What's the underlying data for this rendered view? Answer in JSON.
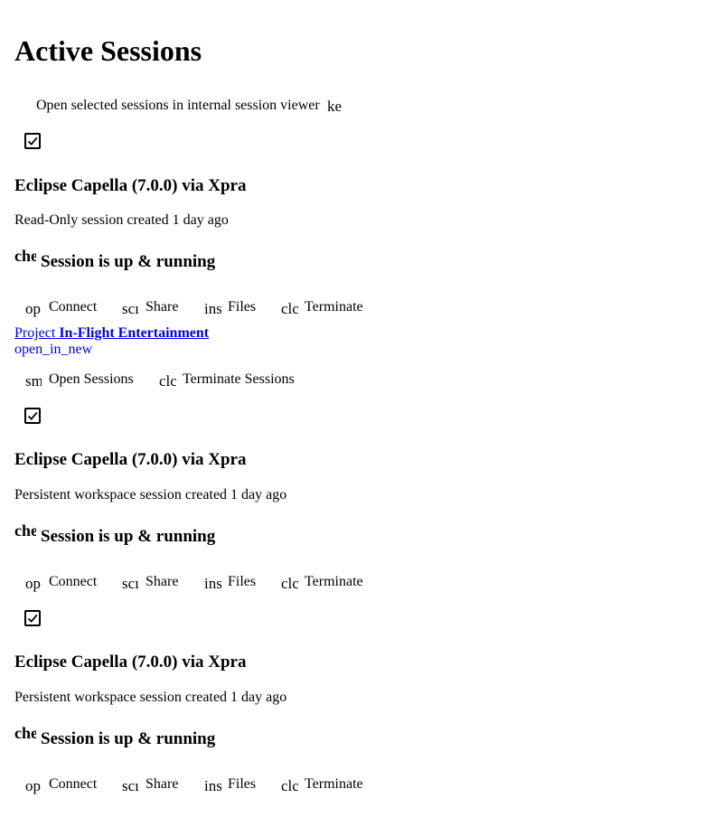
{
  "page": {
    "title": "Active Sessions"
  },
  "toolbar": {
    "viewer_label": "Open selected sessions in internal session viewer",
    "viewer_icon": "ke"
  },
  "sessions": [
    {
      "checked": true,
      "title": "Eclipse Capella (7.0.0) via Xpra",
      "subtitle": "Read-Only session created 1 day ago",
      "status_icon": "che",
      "status": "Session is up & running",
      "actions": [
        {
          "icon": "op",
          "label": "Connect"
        },
        {
          "icon": "scı",
          "label": "Share"
        },
        {
          "icon": "ins",
          "label": "Files"
        },
        {
          "icon": "clc",
          "label": "Terminate"
        }
      ]
    },
    {
      "checked": true,
      "title": "Eclipse Capella (7.0.0) via Xpra",
      "subtitle": "Persistent workspace session created 1 day ago",
      "status_icon": "che",
      "status": "Session is up & running",
      "actions": [
        {
          "icon": "op",
          "label": "Connect"
        },
        {
          "icon": "scı",
          "label": "Share"
        },
        {
          "icon": "ins",
          "label": "Files"
        },
        {
          "icon": "clc",
          "label": "Terminate"
        }
      ]
    },
    {
      "checked": true,
      "title": "Eclipse Capella (7.0.0) via Xpra",
      "subtitle": "Persistent workspace session created 1 day ago",
      "status_icon": "che",
      "status": "Session is up & running",
      "actions": [
        {
          "icon": "op",
          "label": "Connect"
        },
        {
          "icon": "scı",
          "label": "Share"
        },
        {
          "icon": "ins",
          "label": "Files"
        },
        {
          "icon": "clc",
          "label": "Terminate"
        }
      ]
    }
  ],
  "project": {
    "prefix": "Project",
    "name": "In-Flight Entertainment",
    "open_icon": "open_in_new",
    "actions": [
      {
        "icon": "sm",
        "label": "Open Sessions"
      },
      {
        "icon": "clc",
        "label": "Terminate Sessions"
      }
    ]
  }
}
